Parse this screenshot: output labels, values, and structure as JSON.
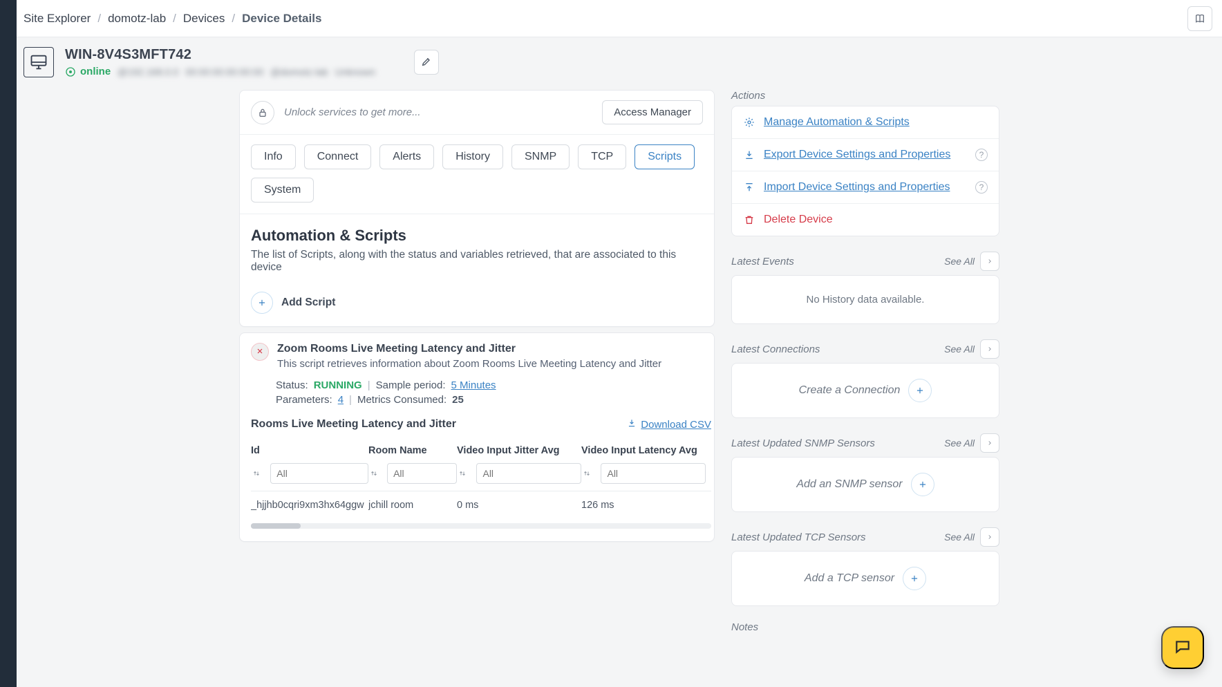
{
  "breadcrumbs": [
    "Site Explorer",
    "domotz-lab",
    "Devices",
    "Device Details"
  ],
  "device": {
    "name": "WIN-8V4S3MFT742",
    "status_label": "online",
    "ip_blur": "@192.168.0.0",
    "mac_blur": "00:00:00:00:00:00",
    "site_blur": "@domotz-lab",
    "extra_blur": "Unknown"
  },
  "unlock": {
    "text": "Unlock services to get more...",
    "button": "Access Manager"
  },
  "tabs": [
    "Info",
    "Connect",
    "Alerts",
    "History",
    "SNMP",
    "TCP",
    "Scripts",
    "System"
  ],
  "active_tab_index": 6,
  "scripts_section": {
    "title": "Automation & Scripts",
    "description": "The list of Scripts, along with the status and variables retrieved, that are associated to this device",
    "add_label": "Add Script"
  },
  "script": {
    "title": "Zoom Rooms Live Meeting Latency and Jitter",
    "description": "This script retrieves information about Zoom Rooms Live Meeting Latency and Jitter",
    "status_label": "Status:",
    "status_value": "RUNNING",
    "sample_label": "Sample period:",
    "sample_value": "5 Minutes",
    "params_label": "Parameters:",
    "params_value": "4",
    "metrics_label": "Metrics Consumed:",
    "metrics_value": "25",
    "table_title": "Rooms Live Meeting Latency and Jitter",
    "download_label": "Download CSV",
    "columns": [
      "Id",
      "Room Name",
      "Video Input Jitter Avg",
      "Video Input Latency Avg"
    ],
    "filter_placeholder": "All",
    "rows": [
      {
        "id": "_hjjhb0cqri9xm3hx64ggw",
        "room": "jchill room",
        "jitter": "0 ms",
        "latency": "126 ms"
      }
    ]
  },
  "actions": {
    "title": "Actions",
    "items": {
      "manage": "Manage Automation & Scripts",
      "export": "Export Device Settings and Properties",
      "import": "Import Device Settings and Properties",
      "delete": "Delete Device"
    }
  },
  "latest_events": {
    "title": "Latest Events",
    "see_all": "See All",
    "empty": "No History data available."
  },
  "latest_connections": {
    "title": "Latest Connections",
    "see_all": "See All",
    "create": "Create a Connection"
  },
  "snmp": {
    "title": "Latest Updated SNMP Sensors",
    "see_all": "See All",
    "add": "Add an SNMP sensor"
  },
  "tcp": {
    "title": "Latest Updated TCP Sensors",
    "see_all": "See All",
    "add": "Add a TCP sensor"
  },
  "notes": {
    "title": "Notes"
  }
}
